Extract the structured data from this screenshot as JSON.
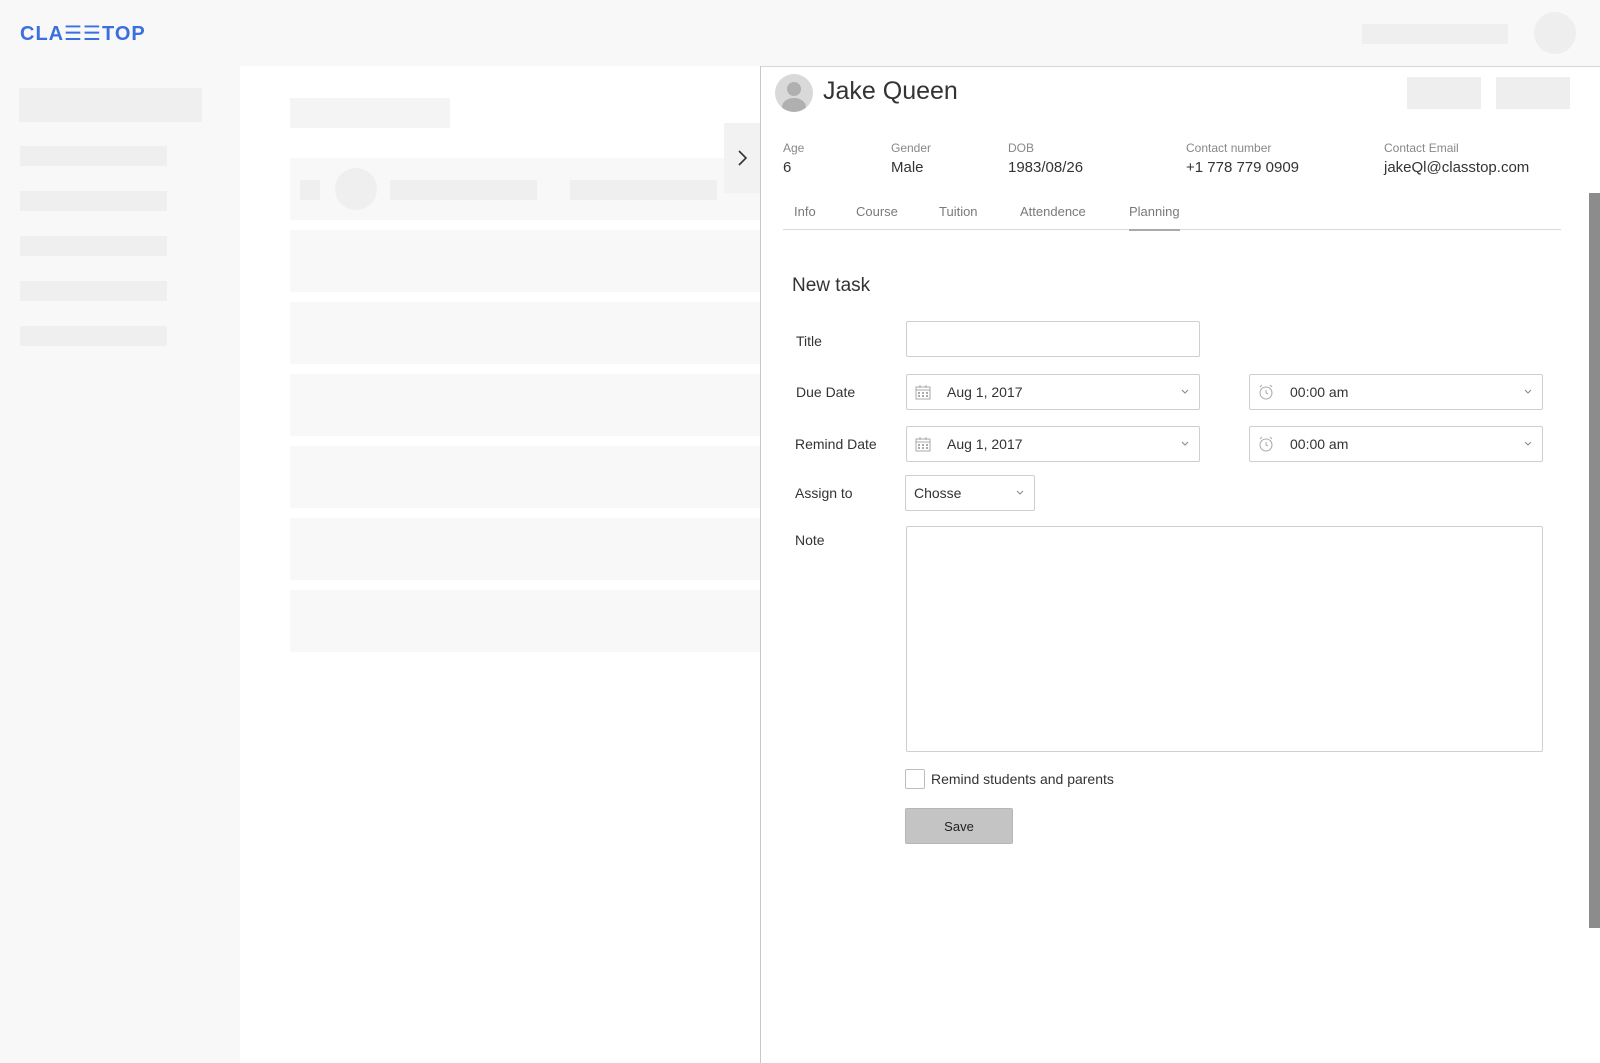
{
  "header": {
    "logo_text": "CLA☰☰TOP"
  },
  "panel": {
    "student_name": "Jake Queen",
    "info": [
      {
        "label": "Age",
        "value": "6"
      },
      {
        "label": "Gender",
        "value": "Male"
      },
      {
        "label": "DOB",
        "value": "1983/08/26"
      },
      {
        "label": "Contact number",
        "value": "+1 778 779 0909"
      },
      {
        "label": "Contact Email",
        "value": "jakeQl@classtop.com"
      }
    ],
    "tabs": [
      {
        "label": "Info",
        "active": false
      },
      {
        "label": "Course",
        "active": false
      },
      {
        "label": "Tuition",
        "active": false
      },
      {
        "label": "Attendence",
        "active": false
      },
      {
        "label": "Planning",
        "active": true
      }
    ]
  },
  "task_form": {
    "title": "New task",
    "title_label": "Title",
    "title_value": "",
    "due_date_label": "Due Date",
    "due_date_value": "Aug 1, 2017",
    "due_time_value": "00:00 am",
    "remind_date_label": "Remind Date",
    "remind_date_value": "Aug 1, 2017",
    "remind_time_value": "00:00 am",
    "assign_label": "Assign to",
    "assign_value": "Chosse",
    "note_label": "Note",
    "note_value": "",
    "remind_checkbox_label": "Remind students and parents",
    "remind_checked": false,
    "save_label": "Save"
  },
  "colors": {
    "brand": "#3a6fe0",
    "save_button": "#c4c4c4",
    "scrollbar": "#8c8c8c"
  }
}
